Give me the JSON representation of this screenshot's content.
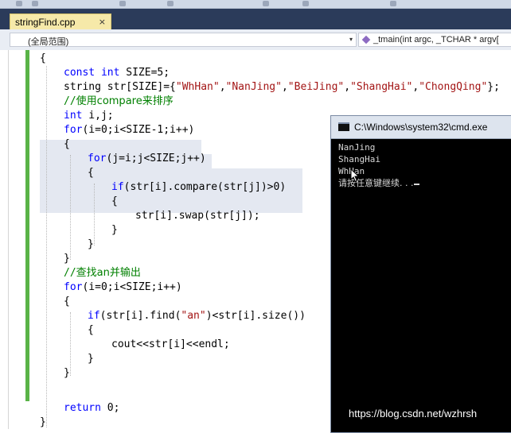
{
  "tab": {
    "title": "stringFind.cpp",
    "close_glyph": "×"
  },
  "navbar": {
    "scope": "(全局范围)",
    "scope_arrow": "▾",
    "member": "_tmain(int argc, _TCHAR * argv[",
    "member_icon": "method-icon"
  },
  "code": {
    "l1": {
      "t": "{"
    },
    "l2": {
      "kw1": "const",
      "kw2": "int",
      "rest": " SIZE=5;"
    },
    "l3": {
      "t": "string str[SIZE]={",
      "s1": "\"WhHan\"",
      "s2": "\"NanJing\"",
      "s3": "\"BeiJing\"",
      "s4": "\"ShangHai\"",
      "s5": "\"ChongQing\"",
      "end": "};"
    },
    "l4": {
      "slashes": "//",
      "a": "使用",
      "b": "compare",
      "c": "来排序"
    },
    "l5": {
      "kw": "int",
      "rest": " i,j;"
    },
    "l6": {
      "kw": "for",
      "rest": "(i=0;i<SIZE-1;i++)"
    },
    "l7": {
      "t": "{"
    },
    "l8": {
      "kw": "for",
      "rest": "(j=i;j<SIZE;j++)"
    },
    "l9": {
      "t": "{"
    },
    "l10": {
      "kw": "if",
      "rest": "(str[i].compare(str[j])>0)"
    },
    "l11": {
      "t": "{"
    },
    "l12": {
      "t": "str[i].swap(str[j]);"
    },
    "l13": {
      "t": "}"
    },
    "l14": {
      "t": "}"
    },
    "l15": {
      "t": "}"
    },
    "l16": {
      "slashes": "//",
      "a": "查找",
      "b": "an",
      "c": "并输出"
    },
    "l17": {
      "kw": "for",
      "rest": "(i=0;i<SIZE;i++)"
    },
    "l18": {
      "t": "{"
    },
    "l19": {
      "kw": "if",
      "a": "(str[i].find(",
      "s": "\"an\"",
      "b": ")<str[i].size())"
    },
    "l20": {
      "t": "{"
    },
    "l21": {
      "t": "cout<<str[i]<<endl;"
    },
    "l22": {
      "t": "}"
    },
    "l23": {
      "t": "}"
    },
    "l24": {
      "kw": "return",
      "rest": " 0;"
    },
    "l25": {
      "t": "}"
    }
  },
  "console": {
    "title": "C:\\Windows\\system32\\cmd.exe",
    "lines": [
      "NanJing",
      "ShangHai",
      "WhHan",
      "请按任意键继续. . ."
    ]
  },
  "watermark": "https://blog.csdn.net/wzhrsh",
  "colors": {
    "keyword": "#0000ff",
    "string": "#a31515",
    "comment": "#008000",
    "tab_active": "#f6e9a9",
    "change_bar": "#59b347",
    "console_bg": "#000000"
  }
}
